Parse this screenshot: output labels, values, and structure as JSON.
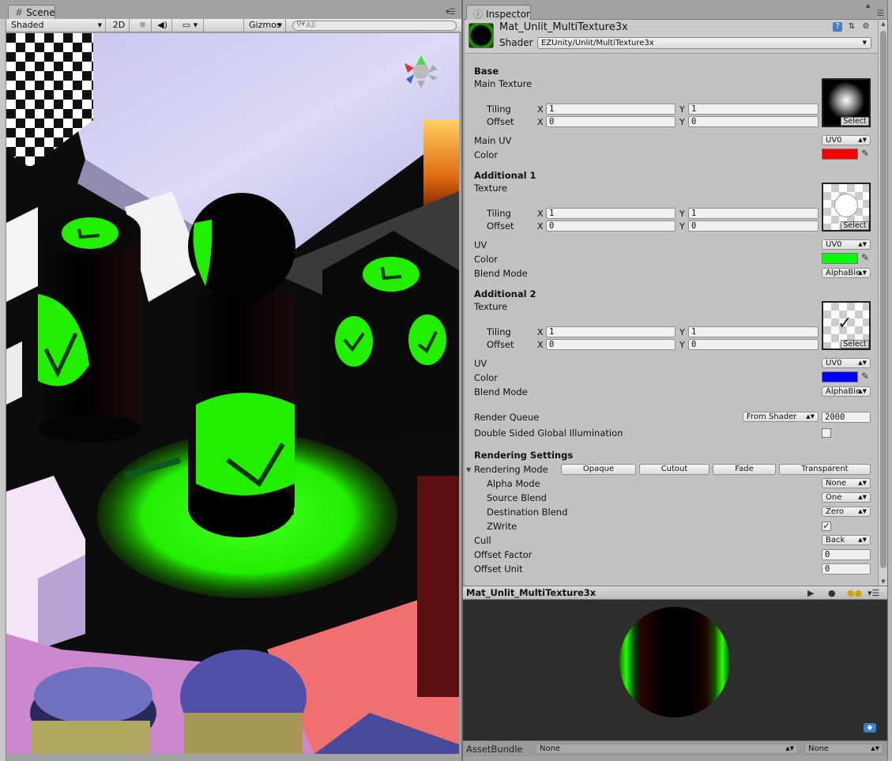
{
  "scene": {
    "tab_label": "Scene",
    "shading_mode": "Shaded",
    "btn_2d": "2D",
    "gizmos_label": "Gizmos",
    "search_placeholder": "All"
  },
  "inspector": {
    "tab_label": "Inspector",
    "material_name": "Mat_Unlit_MultiTexture3x",
    "shader_label": "Shader",
    "shader_value": "EZUnity/Unlit/MultiTexture3x",
    "sections": {
      "base": {
        "title": "Base",
        "texture_label": "Main Texture",
        "tiling_label": "Tiling",
        "offset_label": "Offset",
        "tiling_x": "1",
        "tiling_y": "1",
        "offset_x": "0",
        "offset_y": "0",
        "uv_label": "Main UV",
        "uv_value": "UV0",
        "color_label": "Color",
        "color_value": "#ff0000"
      },
      "add1": {
        "title": "Additional 1",
        "texture_label": "Texture",
        "tiling_label": "Tiling",
        "offset_label": "Offset",
        "tiling_x": "1",
        "tiling_y": "1",
        "offset_x": "0",
        "offset_y": "0",
        "uv_label": "UV",
        "uv_value": "UV0",
        "color_label": "Color",
        "color_value": "#00ff00",
        "blend_label": "Blend Mode",
        "blend_value": "AlphaBle"
      },
      "add2": {
        "title": "Additional 2",
        "texture_label": "Texture",
        "tiling_label": "Tiling",
        "offset_label": "Offset",
        "tiling_x": "1",
        "tiling_y": "1",
        "offset_x": "0",
        "offset_y": "0",
        "uv_label": "UV",
        "uv_value": "UV0",
        "color_label": "Color",
        "color_value": "#0000ff",
        "blend_label": "Blend Mode",
        "blend_value": "AlphaBle"
      }
    },
    "select_label": "Select",
    "x_label": "X",
    "y_label": "Y",
    "render_queue_label": "Render Queue",
    "render_queue_source": "From Shader",
    "render_queue_value": "2000",
    "double_sided_gi_label": "Double Sided Global Illumination",
    "double_sided_gi_checked": false,
    "rendering_settings_title": "Rendering Settings",
    "rendering_mode_label": "Rendering Mode",
    "rendering_modes": [
      "Opaque",
      "Cutout",
      "Fade",
      "Transparent"
    ],
    "alpha_mode_label": "Alpha Mode",
    "alpha_mode_value": "None",
    "source_blend_label": "Source Blend",
    "source_blend_value": "One",
    "dest_blend_label": "Destination Blend",
    "dest_blend_value": "Zero",
    "zwrite_label": "ZWrite",
    "zwrite_checked": true,
    "cull_label": "Cull",
    "cull_value": "Back",
    "offset_factor_label": "Offset Factor",
    "offset_factor_value": "0",
    "offset_unit_label": "Offset Unit",
    "offset_unit_value": "0"
  },
  "preview": {
    "title": "Mat_Unlit_MultiTexture3x"
  },
  "assetbundle": {
    "label": "AssetBundle",
    "name_value": "None",
    "variant_value": "None"
  },
  "icons": [
    "grid-icon",
    "kebab-menu-icon",
    "info-icon",
    "lock-icon",
    "gear-icon",
    "help-icon",
    "eyedropper-icon",
    "play-icon",
    "sphere-icon",
    "light-icon",
    "tag-icon",
    "sun-icon",
    "audio-icon",
    "image-icon",
    "search-icon"
  ]
}
